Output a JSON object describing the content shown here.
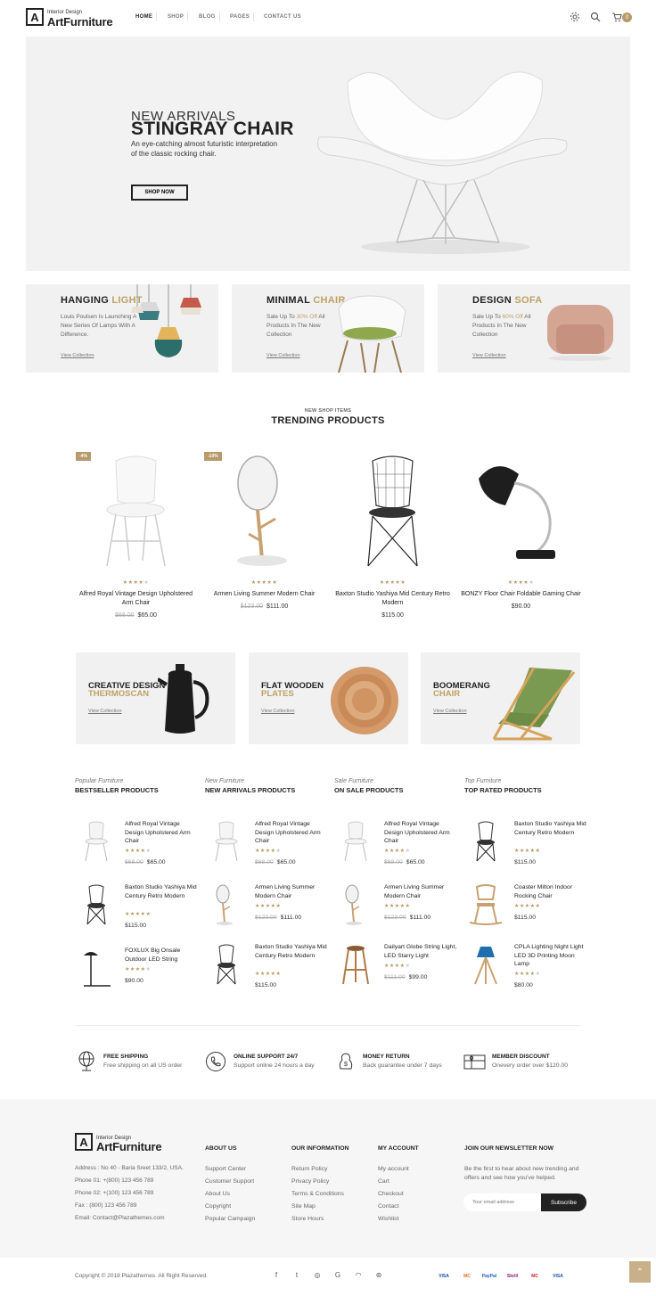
{
  "brand": {
    "small": "Interior Design",
    "big": "ArtFurniture",
    "mark": "A"
  },
  "nav": [
    {
      "label": "HOME"
    },
    {
      "label": "SHOP"
    },
    {
      "label": "BLOG"
    },
    {
      "label": "PAGES"
    },
    {
      "label": "CONTACT US"
    }
  ],
  "header_icons": [
    "gear-icon",
    "search-icon",
    "cart-icon"
  ],
  "cart_count": "0",
  "hero": {
    "subtitle": "NEW ARRIVALS",
    "title": "STINGRAY CHAIR",
    "description": "An eye-catching almost futuristic interpretation of the classic rocking chair.",
    "button": "SHOP NOW"
  },
  "banners": [
    {
      "title": "HANGING",
      "accent": "LIGHT",
      "desc": "Louis Poulsen Is Launching A New Series Of Lamps With A Difference.",
      "link": "View Collection"
    },
    {
      "title": "MINIMAL",
      "accent": "CHAIR",
      "desc_pre": "Sale Up To ",
      "highlight": "30% Off",
      "desc_post": " All Products In The New Collection",
      "link": "View Collection"
    },
    {
      "title": "DESIGN",
      "accent": "SOFA",
      "desc_pre": "Sale Up To ",
      "highlight": "60% Off",
      "desc_post": " All Products In The New Collection",
      "link": "View Collection"
    }
  ],
  "trending": {
    "subtitle": "NEW SHOP ITEMS",
    "title": "TRENDING PRODUCTS",
    "products": [
      {
        "name": "Alfred Royal Vintage Design Upholstered Arm Chair",
        "old": "$68.00",
        "price": "$65.00",
        "badge": "-4%",
        "rating": 4
      },
      {
        "name": "Armen Living Summer Modern Chair",
        "old": "$123.00",
        "price": "$111.00",
        "badge": "-10%",
        "rating": 5
      },
      {
        "name": "Baxton Studio Yashiya Mid Century Retro Modern",
        "old": "",
        "price": "$115.00",
        "badge": "",
        "rating": 5
      },
      {
        "name": "BONZY Floor Chair Foldable Gaming Chair",
        "old": "",
        "price": "$90.00",
        "badge": "",
        "rating": 4
      }
    ]
  },
  "promo": [
    {
      "title": "CREATIVE DESIGN",
      "accent": "THERMOSCAN",
      "link": "View Collection"
    },
    {
      "title": "FLAT WOODEN",
      "accent": "PLATES",
      "link": "View Collection"
    },
    {
      "title": "BOOMERANG",
      "accent": "CHAIR",
      "link": "View Collection"
    }
  ],
  "lists": [
    {
      "sub": "Popular Furniture",
      "title": "BESTSELLER PRODUCTS",
      "items": [
        {
          "name": "Alfred Royal Vintage Design Upholstered Arm Chair",
          "old": "$68.00",
          "price": "$65.00",
          "rating": 4
        },
        {
          "name": "Baxton Studio Yashiya Mid Century Retro Modern",
          "old": "",
          "price": "$115.00",
          "rating": 5
        },
        {
          "name": "FOXLUX Big Onsale Outdoor LED String",
          "old": "",
          "price": "$90.00",
          "rating": 4
        }
      ]
    },
    {
      "sub": "New Furniture",
      "title": "NEW ARRIVALS PRODUCTS",
      "items": [
        {
          "name": "Alfred Royal Vintage Design Upholstered Arm Chair",
          "old": "$68.00",
          "price": "$65.00",
          "rating": 4
        },
        {
          "name": "Armen Living Summer Modern Chair",
          "old": "$123.00",
          "price": "$111.00",
          "rating": 5
        },
        {
          "name": "Baxton Studio Yashiya Mid Century Retro Modern",
          "old": "",
          "price": "$115.00",
          "rating": 5
        }
      ]
    },
    {
      "sub": "Sale Furniture",
      "title": "ON SALE PRODUCTS",
      "items": [
        {
          "name": "Alfred Royal Vintage Design Upholstered Arm Chair",
          "old": "$68.00",
          "price": "$65.00",
          "rating": 4
        },
        {
          "name": "Armen Living Summer Modern Chair",
          "old": "$123.00",
          "price": "$111.00",
          "rating": 5
        },
        {
          "name": "Dailyart Globe String Light, LED Starry Light",
          "old": "$111.00",
          "price": "$99.00",
          "rating": 4
        }
      ]
    },
    {
      "sub": "Top Furniture",
      "title": "TOP RATED PRODUCTS",
      "items": [
        {
          "name": "Baxton Studio Yashiya Mid Century Retro Modern",
          "old": "",
          "price": "$115.00",
          "rating": 5
        },
        {
          "name": "Coaster Milton Indoor Rocking Chair",
          "old": "",
          "price": "$115.00",
          "rating": 5
        },
        {
          "name": "CPLA Lighting Night Light LED 3D Printing Moon Lamp",
          "old": "",
          "price": "$80.00",
          "rating": 4
        }
      ]
    }
  ],
  "services": [
    {
      "title": "FREE SHIPPING",
      "desc": "Free shipping on all US order",
      "icon": "globe-icon"
    },
    {
      "title": "ONLINE SUPPORT 24/7",
      "desc": "Support online 24 hours a day",
      "icon": "phone-icon"
    },
    {
      "title": "MONEY RETURN",
      "desc": "Back guarantee under 7 days",
      "icon": "money-icon"
    },
    {
      "title": "MEMBER DISCOUNT",
      "desc": "Onevery order over $120.00",
      "icon": "gift-icon"
    }
  ],
  "footer": {
    "info": [
      "Address : No 40 - Baria Sreet 133/2, USA.",
      "Phone 01: +(800) 123 456 789",
      "Phone 02: +(100) 123 456 789",
      "Fax : (800) 123 456 789",
      "Email: Contact@Plazathemes.com"
    ],
    "cols": [
      {
        "title": "ABOUT US",
        "links": [
          "Support Center",
          "Customer Support",
          "About Us",
          "Copyright",
          "Popular Campaign"
        ]
      },
      {
        "title": "OUR INFORMATION",
        "links": [
          "Return Policy",
          "Privacy Policy",
          "Terms & Conditions",
          "Site Map",
          "Store Hours"
        ]
      },
      {
        "title": "MY ACCOUNT",
        "links": [
          "My account",
          "Cart",
          "Checkout",
          "Contact",
          "Wishlist"
        ]
      }
    ],
    "newsletter": {
      "title": "JOIN OUR NEWSLETTER NOW",
      "desc": "Be the first to hear about new trending and offers and see how you've helped.",
      "placeholder": "Your email address",
      "button": "Subscribe"
    },
    "copyright": "Copyright © 2018 Plazathemes. All Right Reserved.",
    "social": [
      {
        "icon": "facebook-icon",
        "glyph": "f"
      },
      {
        "icon": "twitter-icon",
        "glyph": "t"
      },
      {
        "icon": "instagram-icon",
        "glyph": "◎"
      },
      {
        "icon": "google-icon",
        "glyph": "G"
      },
      {
        "icon": "rss-icon",
        "glyph": "◠"
      },
      {
        "icon": "dribbble-icon",
        "glyph": "⊛"
      }
    ],
    "payments": [
      {
        "label": "VISA",
        "color": "#1a4fa0"
      },
      {
        "label": "MC",
        "color": "#eb6b22"
      },
      {
        "label": "PayPal",
        "color": "#1b5fb5"
      },
      {
        "label": "Skrill",
        "color": "#862165"
      },
      {
        "label": "MC",
        "color": "#d0202f"
      },
      {
        "label": "VISA",
        "color": "#1a4fa0"
      }
    ]
  },
  "colors": {
    "accent": "#b79a6a",
    "dark": "#222222",
    "banner_bg": "#f1f1f1"
  }
}
